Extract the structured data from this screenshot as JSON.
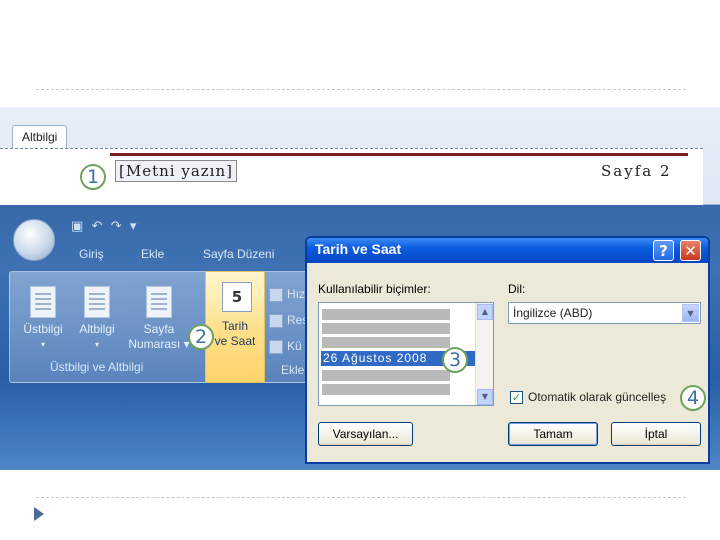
{
  "header": {
    "tab_label": "Altbilgi",
    "field_text": "[Metni yazın]",
    "page_text": "Sayfa 2"
  },
  "callouts": [
    "1",
    "2",
    "3",
    "4"
  ],
  "ribbon": {
    "tabs": [
      "Giriş",
      "Ekle",
      "Sayfa Düzeni"
    ],
    "buttons": [
      {
        "label_line1": "Üstbilgi",
        "label_line2": "▾"
      },
      {
        "label_line1": "Altbilgi",
        "label_line2": "▾"
      },
      {
        "label_line1": "Sayfa",
        "label_line2": "Numarası ▾"
      }
    ],
    "group_label": "Üstbilgi ve Altbilgi",
    "date_button": {
      "icon_number": "5",
      "label_line1": "Tarih",
      "label_line2": "ve Saat"
    },
    "side_items": [
      "Hız",
      "Res",
      "Kü"
    ],
    "group2_label": "Ekle"
  },
  "dialog": {
    "title": "Tarih ve Saat",
    "help_label": "?",
    "close_label": "✕",
    "formats_label": "Kullanılabilir biçimler:",
    "selected_format": "26 Ağustos 2008",
    "language_label": "Dil:",
    "language_value": "İngilizce (ABD)",
    "auto_update_label": "Otomatik olarak güncelleş",
    "auto_update_checked": true,
    "default_button": "Varsayılan...",
    "ok_button": "Tamam",
    "cancel_button": "İptal"
  },
  "colors": {
    "accent_blue": "#0b5be0",
    "callout_border": "#6fa15f",
    "selection": "#316ac5"
  }
}
